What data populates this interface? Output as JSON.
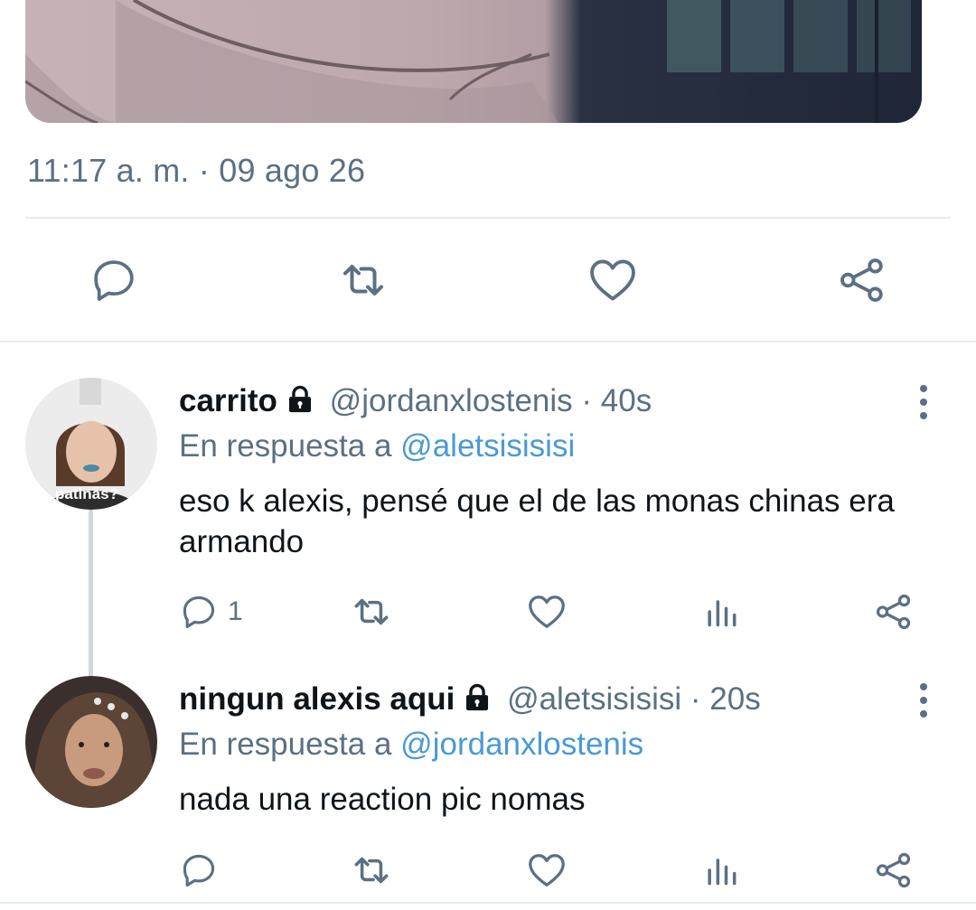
{
  "tweet": {
    "timestamp": "11:17 a. m. · 09 ago 26",
    "actions": [
      {
        "name": "reply-button",
        "icon": "reply-icon"
      },
      {
        "name": "retweet-button",
        "icon": "retweet-icon"
      },
      {
        "name": "like-button",
        "icon": "heart-icon"
      },
      {
        "name": "share-button",
        "icon": "share-icon"
      }
    ]
  },
  "replies": [
    {
      "display_name": "carrito",
      "handle": "@jordanxlostenis",
      "separator": "·",
      "time": "40s",
      "reply_prefix": "En respuesta a",
      "reply_mention": "@aletsisisisi",
      "text": "eso k alexis, pensé que el de las monas chinas era armando",
      "avatar_caption": "patinas?",
      "reply_count": "1"
    },
    {
      "display_name": "ningun alexis aqui",
      "handle": "@aletsisisisi",
      "separator": "·",
      "time": "20s",
      "reply_prefix": "En respuesta a",
      "reply_mention": "@jordanxlostenis",
      "text": "nada una reaction pic nomas",
      "reply_count": ""
    }
  ],
  "colors": {
    "secondary_text": "#5b7083",
    "mention": "#4a9ad4",
    "divider": "#e6ecf0",
    "primary_text": "#0f1419"
  }
}
